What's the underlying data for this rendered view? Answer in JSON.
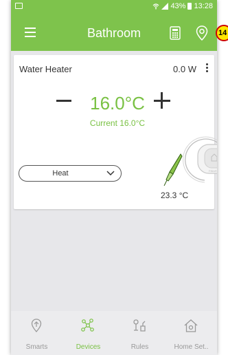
{
  "statusbar": {
    "battery": "43%",
    "time": "13:28"
  },
  "appbar": {
    "title": "Bathroom"
  },
  "badge": {
    "text": "14"
  },
  "device": {
    "name": "Water Heater",
    "power": "0.0 W",
    "setpoint": "16.0°C",
    "current": "Current 16.0°C",
    "mode": "Heat",
    "probe_temp": "23.3 °C"
  },
  "nav": {
    "items": [
      {
        "label": "Smarts",
        "icon": "smarts-icon",
        "active": false
      },
      {
        "label": "Devices",
        "icon": "devices-icon",
        "active": true
      },
      {
        "label": "Rules",
        "icon": "rules-icon",
        "active": false
      },
      {
        "label": "Home Set..",
        "icon": "home-settings-icon",
        "active": false
      }
    ]
  },
  "colors": {
    "brand": "#7ec34c",
    "accent_text": "#79c143",
    "inactive": "#999999"
  }
}
